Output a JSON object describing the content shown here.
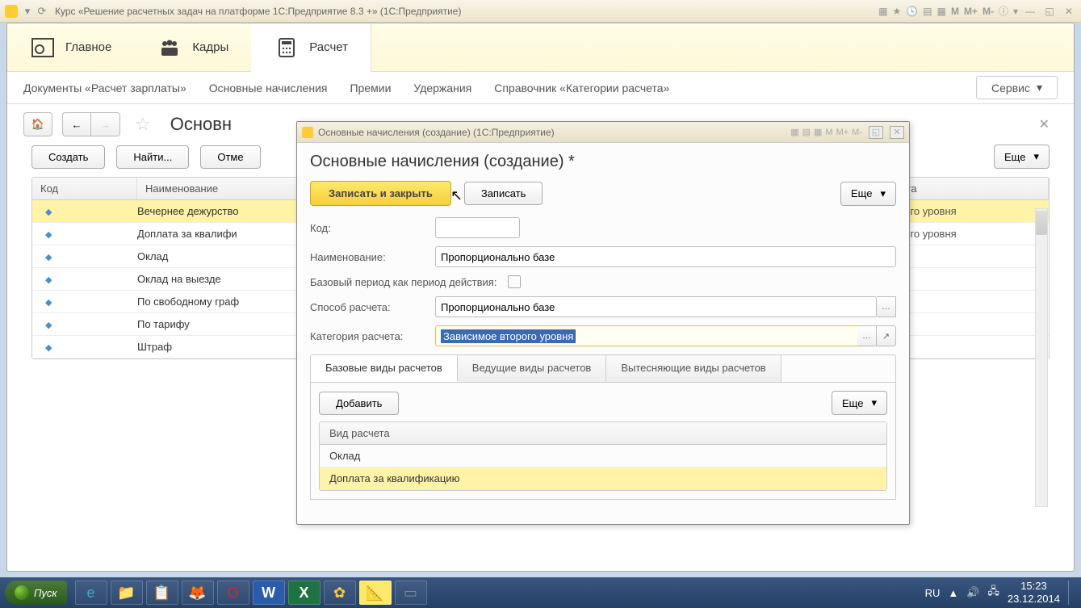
{
  "titlebar": {
    "title": "Курс «Решение расчетных задач на платформе 1С:Предприятие 8.3 +»  (1С:Предприятие)",
    "m": "M",
    "mp": "M+",
    "mm": "M-"
  },
  "sections": {
    "main": "Главное",
    "staff": "Кадры",
    "calc": "Расчет"
  },
  "subnav": {
    "docs": "Документы «Расчет зарплаты»",
    "basic": "Основные начисления",
    "bonus": "Премии",
    "deduct": "Удержания",
    "catref": "Справочник «Категории расчета»",
    "service": "Сервис"
  },
  "page": {
    "title_truncated": "Основн",
    "create": "Создать",
    "find": "Найти...",
    "cancel": "Отме",
    "more": "Еще"
  },
  "table": {
    "col_code": "Код",
    "col_name": "Наименование",
    "col_cat": "чета",
    "rows": [
      {
        "name": "Вечернее дежурство",
        "cat": "рового уровня",
        "selected": true
      },
      {
        "name": "Доплата за квалифи",
        "cat": "рового уровня"
      },
      {
        "name": "Оклад"
      },
      {
        "name": "Оклад на выезде"
      },
      {
        "name": "По свободному граф"
      },
      {
        "name": "По тарифу"
      },
      {
        "name": "Штраф"
      }
    ]
  },
  "modal": {
    "wintitle": "Основные начисления (создание)  (1С:Предприятие)",
    "heading": "Основные начисления (создание) *",
    "save_close": "Записать и закрыть",
    "save": "Записать",
    "more": "Еще",
    "lbl_code": "Код:",
    "lbl_name": "Наименование:",
    "val_name": "Пропорционально базе",
    "lbl_base_period": "Базовый период как период действия:",
    "lbl_method": "Способ расчета:",
    "val_method": "Пропорционально базе",
    "lbl_category": "Категория расчета:",
    "val_category": "Зависимое второго уровня",
    "tabs": {
      "base": "Базовые виды расчетов",
      "leading": "Ведущие виды расчетов",
      "displacing": "Вытесняющие виды расчетов"
    },
    "add": "Добавить",
    "inner_col": "Вид расчета",
    "inner_rows": [
      "Оклад",
      "Доплата за квалификацию"
    ],
    "m": "M",
    "mp": "M+",
    "mm": "M-"
  },
  "taskbar": {
    "start": "Пуск",
    "lang": "RU",
    "time": "15:23",
    "date": "23.12.2014"
  }
}
